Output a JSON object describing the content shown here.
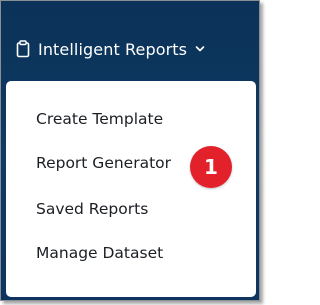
{
  "nav": {
    "icon": "clipboard-icon",
    "label": "Intelligent Reports",
    "chevron": "chevron-down-icon"
  },
  "menu": {
    "items": [
      {
        "label": "Create Template"
      },
      {
        "label": "Report Generator"
      },
      {
        "label": "Saved Reports"
      },
      {
        "label": "Manage Dataset"
      }
    ]
  },
  "callout": {
    "number": "1",
    "color": "#e2212a"
  },
  "colors": {
    "nav_background": "#0f3a63",
    "menu_background": "#ffffff",
    "menu_text": "#1b1f24"
  }
}
